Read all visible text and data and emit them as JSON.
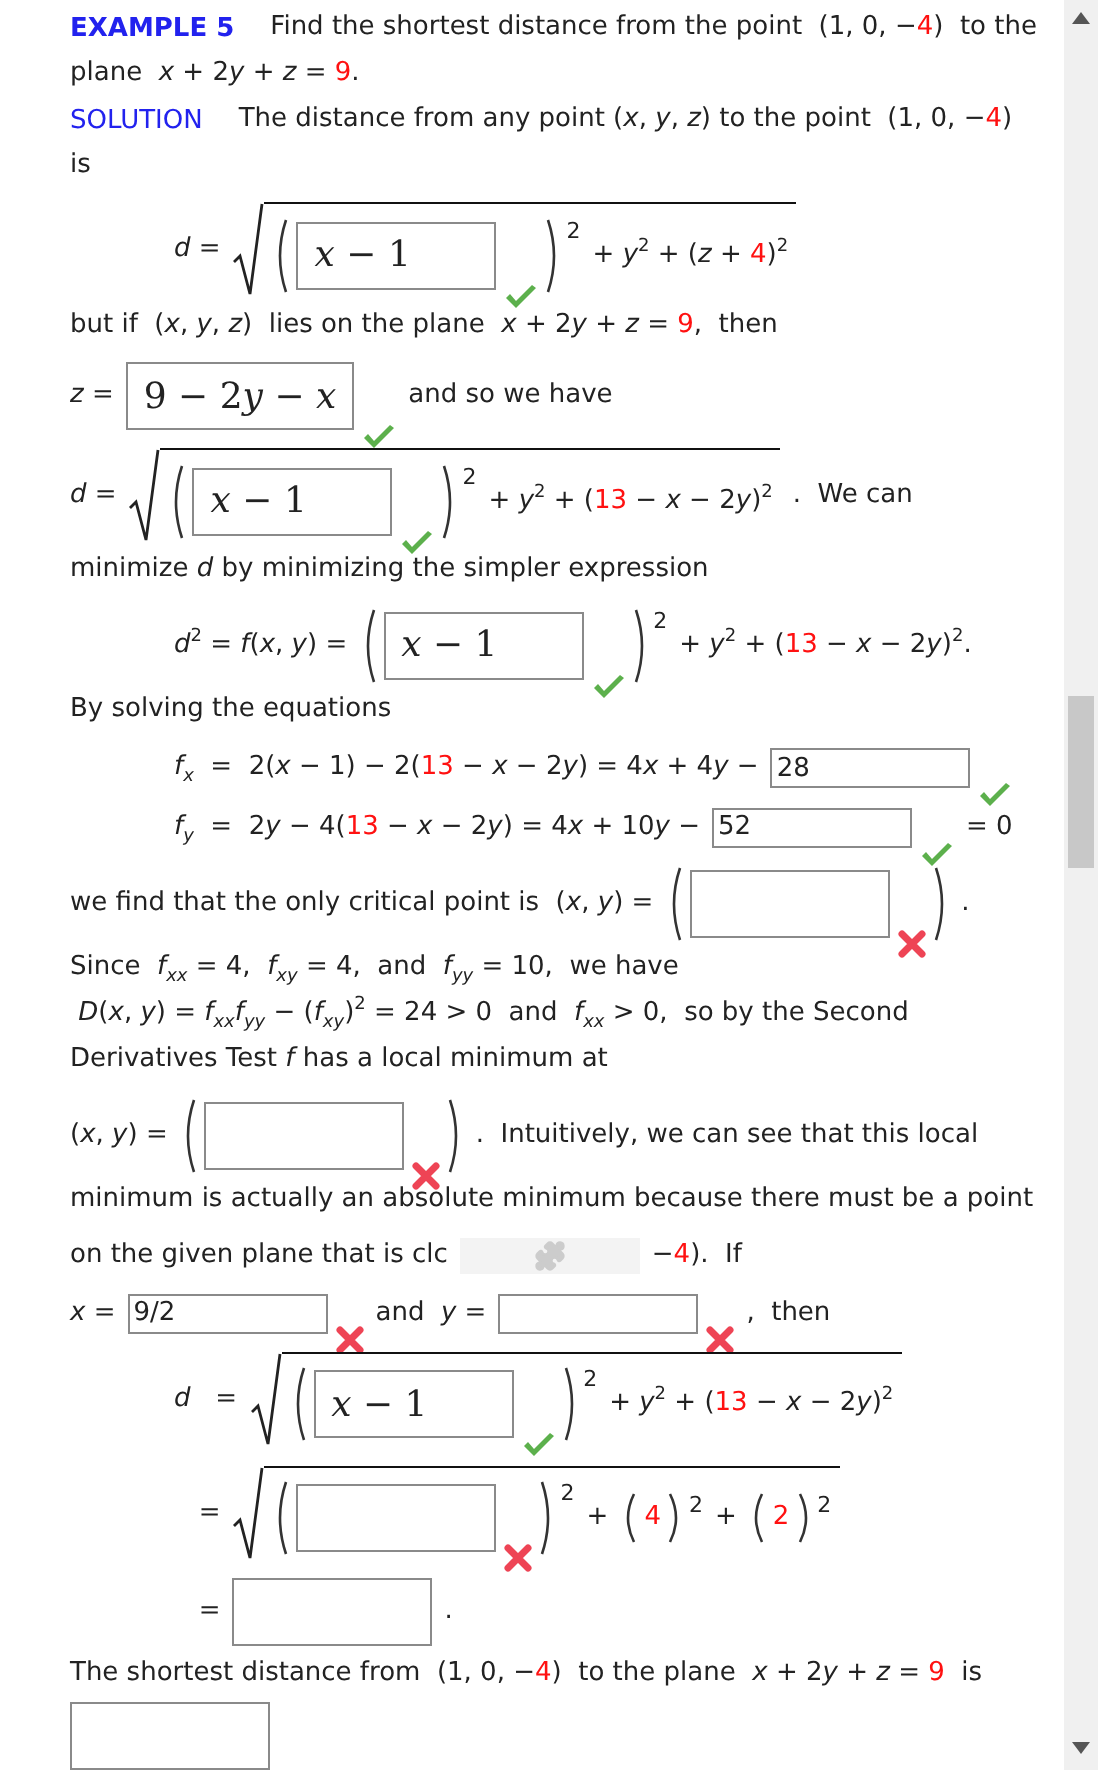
{
  "rows": [
    {
      "kind": "para",
      "items": [
        {
          "kind": "label",
          "bold": true,
          "text": "EXAMPLE 5"
        },
        {
          "kind": "text",
          "parts": [
            "Find the shortest distance from the point  (1, 0, −",
            {
              "red": "4"
            },
            ")  to the"
          ]
        }
      ]
    },
    {
      "kind": "para",
      "items": [
        {
          "kind": "text",
          "parts": [
            "plane  *x* + 2",
            "*y* + *z* = ",
            {
              "red": "9"
            },
            "."
          ]
        }
      ]
    },
    {
      "kind": "para",
      "items": [
        {
          "kind": "label",
          "bold": false,
          "text": "SOLUTION"
        },
        {
          "kind": "text",
          "parts": [
            "The distance from any point (*x*, *y*, *z*) to the point  (1, 0, −",
            {
              "red": "4"
            },
            ")"
          ]
        }
      ]
    },
    {
      "kind": "para",
      "items": [
        {
          "kind": "text",
          "parts": [
            "is"
          ]
        }
      ]
    },
    {
      "kind": "display",
      "items": [
        {
          "kind": "text",
          "parts": [
            "*d* ="
          ]
        },
        {
          "kind": "sqrt",
          "items": [
            {
              "kind": "paren",
              "power": "2",
              "items": [
                {
                  "kind": "math_field",
                  "value": "x − 1",
                  "correct": true
                }
              ]
            },
            {
              "kind": "text",
              "parts": [
                "+ *y*$^{2}$ + (*z* + ",
                {
                  "red": "4"
                },
                ")$^{2}$"
              ]
            }
          ]
        }
      ]
    },
    {
      "kind": "para",
      "items": [
        {
          "kind": "text",
          "parts": [
            "but if  (*x*, *y*, *z*)  lies on the plane  *x* + 2",
            "*y* + *z* = ",
            {
              "red": "9"
            },
            ",  then"
          ]
        }
      ]
    },
    {
      "kind": "line",
      "items": [
        {
          "kind": "text",
          "parts": [
            "*z* ="
          ]
        },
        {
          "kind": "math_field",
          "value": "9 − 2y − x",
          "correct": true
        },
        {
          "kind": "text",
          "parts": [
            "and so we have"
          ]
        }
      ]
    },
    {
      "kind": "line",
      "items": [
        {
          "kind": "text",
          "parts": [
            "*d* ="
          ]
        },
        {
          "kind": "sqrt",
          "items": [
            {
              "kind": "paren",
              "power": "2",
              "items": [
                {
                  "kind": "math_field",
                  "value": "x − 1",
                  "correct": true
                }
              ]
            },
            {
              "kind": "text",
              "parts": [
                "+ *y*$^{2}$ + (",
                {
                  "red": "13"
                },
                " − *x* − 2",
                "*y*)$^{2}$"
              ]
            }
          ]
        },
        {
          "kind": "text",
          "parts": [
            ".  We can"
          ]
        }
      ]
    },
    {
      "kind": "para",
      "items": [
        {
          "kind": "text",
          "parts": [
            "minimize *d* by minimizing the simpler expression"
          ]
        }
      ]
    },
    {
      "kind": "display",
      "items": [
        {
          "kind": "text",
          "parts": [
            "*d*$^{2}$ = *f*(*x*, *y*) ="
          ]
        },
        {
          "kind": "paren",
          "power": "2",
          "items": [
            {
              "kind": "math_field",
              "value": "x − 1",
              "correct": true
            }
          ]
        },
        {
          "kind": "text",
          "parts": [
            "+ *y*$^{2}$ + (",
            {
              "red": "13"
            },
            " − *x* − 2",
            "*y*)$^{2}$."
          ]
        }
      ]
    },
    {
      "kind": "para",
      "items": [
        {
          "kind": "text",
          "parts": [
            "By solving the equations"
          ]
        }
      ]
    },
    {
      "kind": "display",
      "items": [
        {
          "kind": "text",
          "parts": [
            "*f*$_{x}$  =  2(*x* − 1) − 2(",
            {
              "red": "13"
            },
            " − *x* − 2",
            "*y*) = 4",
            "*x* + 4",
            "*y* −"
          ]
        },
        {
          "kind": "text_field",
          "value": "28",
          "correct": true
        }
      ]
    },
    {
      "kind": "display",
      "items": [
        {
          "kind": "text",
          "parts": [
            "*f*$_{y}$  =  2",
            "*y* − 4(",
            {
              "red": "13"
            },
            " − *x* − 2",
            "*y*) = 4",
            "*x* + 10",
            "*y* −"
          ]
        },
        {
          "kind": "text_field",
          "value": "52",
          "correct": true
        },
        {
          "kind": "text",
          "parts": [
            "= 0"
          ]
        }
      ]
    },
    {
      "kind": "line",
      "items": [
        {
          "kind": "text",
          "parts": [
            "we find that the only critical point is  (*x*, *y*) ="
          ]
        },
        {
          "kind": "paren",
          "items": [
            {
              "kind": "math_field",
              "value": "",
              "correct": false
            }
          ]
        },
        {
          "kind": "text",
          "parts": [
            "."
          ]
        }
      ]
    },
    {
      "kind": "para",
      "items": [
        {
          "kind": "text",
          "parts": [
            "Since  *f*$_{xx}$ = 4,  *f*$_{xy}$ = 4,  and  *f*$_{yy}$ = 10,  we have"
          ]
        }
      ]
    },
    {
      "kind": "para",
      "items": [
        {
          "kind": "text",
          "parts": [
            " *D*(*x*, *y*) = *f*$_{xx}$",
            "*f*$_{yy}$ − (*f*$_{xy}$)$^{2}$ = 24 > 0  and  *f*$_{xx}$ > 0,  so by the Second"
          ]
        }
      ]
    },
    {
      "kind": "para",
      "items": [
        {
          "kind": "text",
          "parts": [
            "Derivatives Test *f* has a local minimum at"
          ]
        }
      ]
    },
    {
      "kind": "line",
      "items": [
        {
          "kind": "text",
          "parts": [
            "(*x*, *y*) ="
          ]
        },
        {
          "kind": "paren",
          "items": [
            {
              "kind": "math_field",
              "value": "",
              "correct": false
            }
          ]
        },
        {
          "kind": "text",
          "parts": [
            ".  Intuitively, we can see that this local"
          ]
        }
      ]
    },
    {
      "kind": "para",
      "items": [
        {
          "kind": "text",
          "parts": [
            "minimum is actually an absolute minimum because there must be a point"
          ]
        }
      ]
    },
    {
      "kind": "line",
      "items": [
        {
          "kind": "text",
          "parts": [
            "on the given plane that is clc"
          ]
        },
        {
          "kind": "plugin"
        },
        {
          "kind": "text",
          "parts": [
            "−",
            {
              "red": "4"
            },
            ").  If"
          ]
        }
      ]
    },
    {
      "kind": "line",
      "items": [
        {
          "kind": "text",
          "parts": [
            "*x* ="
          ]
        },
        {
          "kind": "text_field",
          "value": "9/2",
          "correct": false
        },
        {
          "kind": "text",
          "parts": [
            "and  *y* ="
          ]
        },
        {
          "kind": "text_field",
          "value": "",
          "correct": false
        },
        {
          "kind": "text",
          "parts": [
            ",  then"
          ]
        }
      ]
    },
    {
      "kind": "display",
      "items": [
        {
          "kind": "text",
          "parts": [
            "*d*   ="
          ]
        },
        {
          "kind": "sqrt",
          "items": [
            {
              "kind": "paren",
              "power": "2",
              "items": [
                {
                  "kind": "math_field",
                  "value": "x − 1",
                  "correct": true
                }
              ]
            },
            {
              "kind": "text",
              "parts": [
                "+ *y*$^{2}$ + (",
                {
                  "red": "13"
                },
                " − *x* − 2",
                "*y*)$^{2}$"
              ]
            }
          ]
        }
      ]
    },
    {
      "kind": "display",
      "items": [
        {
          "kind": "text",
          "parts": [
            "   ="
          ]
        },
        {
          "kind": "sqrt",
          "items": [
            {
              "kind": "paren",
              "power": "2",
              "items": [
                {
                  "kind": "math_field",
                  "value": "",
                  "correct": false
                }
              ]
            },
            {
              "kind": "text",
              "parts": [
                "+"
              ]
            },
            {
              "kind": "paren",
              "power": "2",
              "items": [
                {
                  "kind": "text",
                  "parts": [
                    {
                      "red": "4"
                    }
                  ]
                }
              ]
            },
            {
              "kind": "text",
              "parts": [
                "+"
              ]
            },
            {
              "kind": "paren",
              "power": "2",
              "items": [
                {
                  "kind": "text",
                  "parts": [
                    {
                      "red": "2"
                    }
                  ]
                }
              ]
            }
          ]
        }
      ]
    },
    {
      "kind": "display",
      "items": [
        {
          "kind": "text",
          "parts": [
            "   ="
          ]
        },
        {
          "kind": "math_field",
          "value": ""
        },
        {
          "kind": "text",
          "parts": [
            "."
          ]
        }
      ]
    },
    {
      "kind": "para",
      "items": [
        {
          "kind": "text",
          "parts": [
            "The shortest distance from  (1, 0, −",
            {
              "red": "4"
            },
            ")  to the plane  *x* + 2",
            "*y* + *z* = ",
            {
              "red": "9"
            },
            "  is"
          ]
        }
      ]
    },
    {
      "kind": "cut",
      "items": [
        {
          "kind": "math_field",
          "value": ""
        }
      ]
    }
  ]
}
